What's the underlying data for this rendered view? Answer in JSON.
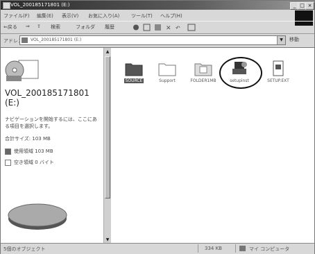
{
  "window": {
    "title": "VOL_200185171801 (E:)",
    "controls": {
      "minimize": "_",
      "maximize": "□",
      "close": "×"
    }
  },
  "menubar": {
    "items": [
      "ファイル(F)",
      "編集(E)",
      "表示(V)",
      "お気に入り(A)",
      "ツール(T)",
      "ヘルプ(H)"
    ]
  },
  "toolbar": {
    "back_label": "⇐戻る",
    "forward_label": "⇒",
    "up_label": "⇧",
    "search_label": "検索",
    "folders_label": "フォルダ",
    "history_label": "履歴"
  },
  "address": {
    "label": "アドレス(D)",
    "value": "VOL_200185171801 (E:)",
    "go_label": "移動"
  },
  "left_pane": {
    "volume_title": "VOL_200185171801",
    "volume_sub": "(E:)",
    "description": "ナビゲーションを開始するには、ここにある項目を選択します。",
    "capacity": "合計サイズ: 103 MB",
    "used": "使用領域 103 MB",
    "free": "空き領域 0 バイト"
  },
  "items": [
    {
      "name": "SOURCE",
      "icon": "folder-icon",
      "selected": true
    },
    {
      "name": "Support",
      "icon": "folder-icon",
      "selected": false
    },
    {
      "name": "FOLDER1MB",
      "icon": "folder-doc-icon",
      "selected": false
    },
    {
      "name": "setupinst",
      "icon": "setup-program-icon",
      "selected": false,
      "circled": true
    },
    {
      "name": "SETUP.EXT",
      "icon": "document-icon",
      "selected": false
    }
  ],
  "statusbar": {
    "left": "5個のオブジェクト",
    "size": "334 KB",
    "zone": "マイ コンピュータ"
  }
}
